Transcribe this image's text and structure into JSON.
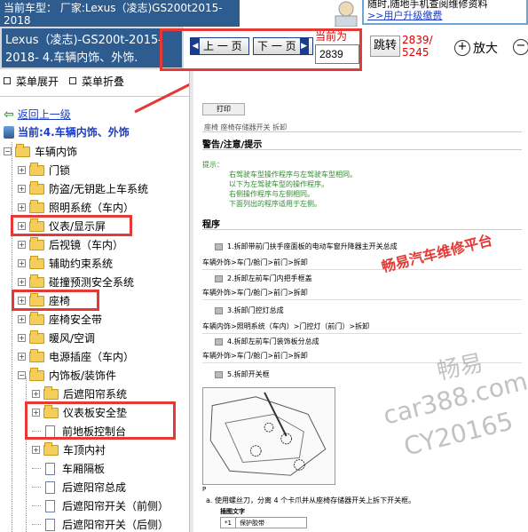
{
  "banner": {
    "model_prefix": "当前车型：",
    "model_text": "厂家:Lexus（凌志)GS200t2015-2018",
    "notice_line1": "随时,随地手机查阅维修资料",
    "upgrade_link": ">>用户升级缴费"
  },
  "title_block": {
    "line1": "Lexus（凌志)-GS200t-2015-",
    "line2": "2018- 4.车辆内饰、外饰."
  },
  "toolbar": {
    "prev_label": "上 一 页",
    "next_label": "下 一 页",
    "current_label": "当前为",
    "page_value": "2839",
    "jump_label": "跳转",
    "page_count_line1": "2839/",
    "page_count_line2": "5245",
    "zoom_in_label": "放大",
    "zoom_in_glyph": "+",
    "zoom_out_glyph": "−"
  },
  "sidebar": {
    "expand_all": "菜单展开",
    "collapse_all": "菜单折叠",
    "back_link": "返回上一级",
    "current_node": "当前:4.车辆内饰、外饰",
    "tree": [
      {
        "label": "车辆内饰",
        "level": 0,
        "type": "folder",
        "expander": "−"
      },
      {
        "label": "门锁",
        "level": 1,
        "type": "folder",
        "expander": "+"
      },
      {
        "label": "防盗/无钥匙上车系统",
        "level": 1,
        "type": "folder",
        "expander": "+"
      },
      {
        "label": "照明系统（车内）",
        "level": 1,
        "type": "folder",
        "expander": "+"
      },
      {
        "label": "仪表/显示屏",
        "level": 1,
        "type": "folder",
        "expander": "+"
      },
      {
        "label": "后视镜（车内）",
        "level": 1,
        "type": "folder",
        "expander": "+"
      },
      {
        "label": "辅助约束系统",
        "level": 1,
        "type": "folder",
        "expander": "+"
      },
      {
        "label": "碰撞预测安全系统",
        "level": 1,
        "type": "folder",
        "expander": "+"
      },
      {
        "label": "座椅",
        "level": 1,
        "type": "folder",
        "expander": "+"
      },
      {
        "label": "座椅安全带",
        "level": 1,
        "type": "folder",
        "expander": "+"
      },
      {
        "label": "暖风/空调",
        "level": 1,
        "type": "folder",
        "expander": "+"
      },
      {
        "label": "电源插座（车内）",
        "level": 1,
        "type": "folder",
        "expander": "+"
      },
      {
        "label": "内饰板/装饰件",
        "level": 1,
        "type": "folder",
        "expander": "−"
      },
      {
        "label": "后遮阳帘系统",
        "level": 2,
        "type": "folder",
        "expander": "+"
      },
      {
        "label": "仪表板安全垫",
        "level": 2,
        "type": "folder",
        "expander": "+"
      },
      {
        "label": "前地板控制台",
        "level": 2,
        "type": "doc",
        "expander": ""
      },
      {
        "label": "车顶内衬",
        "level": 2,
        "type": "folder",
        "expander": "+"
      },
      {
        "label": "车厢隔板",
        "level": 2,
        "type": "doc",
        "expander": ""
      },
      {
        "label": "后遮阳帘总成",
        "level": 2,
        "type": "doc",
        "expander": ""
      },
      {
        "label": "后遮阳帘开关（前侧）",
        "level": 2,
        "type": "doc",
        "expander": ""
      },
      {
        "label": "后遮阳帘开关（后侧）",
        "level": 2,
        "type": "doc",
        "expander": ""
      }
    ]
  },
  "document": {
    "print_label": "打印",
    "breadcrumb": "座椅  座椅存储器开关  拆卸",
    "warning_heading": "警告/注意/提示",
    "tips_title": "提示：",
    "tips": [
      "右驾驶车型操作程序与左驾驶车型相同。",
      "以下为左驾驶车型的操作程序。",
      "右侧操作程序与左侧相同。",
      "下面列出的程序适用于左侧。"
    ],
    "procedure_heading": "程序",
    "step1": "1.拆卸带前门扶手座面板的电动车窗升降器主开关总成",
    "path1": "车辆外饰>车门/舱门>前门>拆卸",
    "step2": "2.拆卸左前车门内把手框盖",
    "path2": "车辆外饰>车门/舱门>前门>拆卸",
    "step3": "3.拆卸门控灯总成",
    "path3": "车辆内饰>照明系统（车内）>门控灯（前门）>拆卸",
    "step4": "4.拆卸左前车门装饰板分总成",
    "path4": "车辆外饰>车门/舱门>前门>拆卸",
    "step5": "5.拆卸开关框",
    "illus_label": "P",
    "step_a": "a.   使用螺丝刀，分离 4 个卡爪并从座椅存储器开关上拆下开关框。",
    "legend_title": "插图文字",
    "legend_num": "*1",
    "legend_text": "保护胶带"
  },
  "watermarks": {
    "brand": "畅易汽车维修平台",
    "cn": "畅易",
    "url": "car388.com",
    "id": "CY20165"
  },
  "colors": {
    "header_blue": "#2f5c8f",
    "highlight_red": "#e53935",
    "link_blue": "#1a3cc8",
    "tip_green": "#2e8b2e"
  }
}
